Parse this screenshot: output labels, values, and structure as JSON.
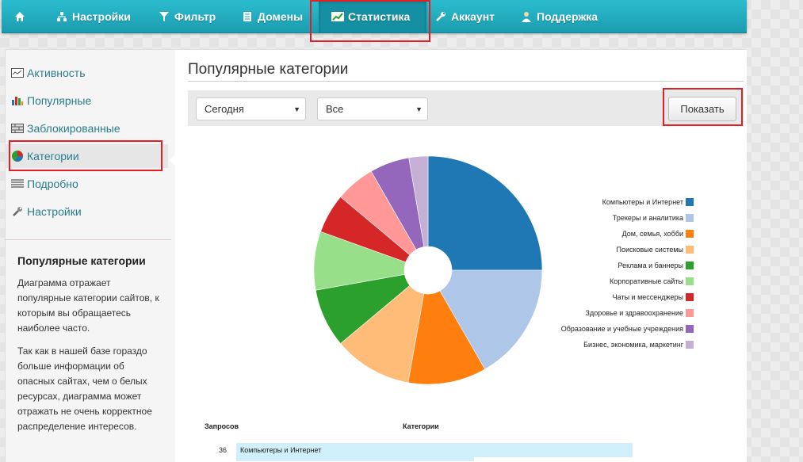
{
  "nav": {
    "home_icon": "home-icon",
    "items": [
      {
        "label": "Настройки",
        "icon": "sitemap-icon"
      },
      {
        "label": "Фильтр",
        "icon": "filter-icon"
      },
      {
        "label": "Домены",
        "icon": "document-icon"
      },
      {
        "label": "Статистика",
        "icon": "chart-icon",
        "active": true
      },
      {
        "label": "Аккаунт",
        "icon": "wrench-icon"
      },
      {
        "label": "Поддержка",
        "icon": "user-icon"
      }
    ]
  },
  "sidebar": {
    "items": [
      {
        "label": "Активность",
        "icon": "activity-icon"
      },
      {
        "label": "Популярные",
        "icon": "bar-chart-icon"
      },
      {
        "label": "Заблокированные",
        "icon": "blocked-icon"
      },
      {
        "label": "Категории",
        "icon": "pie-chart-icon",
        "active": true
      },
      {
        "label": "Подробно",
        "icon": "list-icon"
      },
      {
        "label": "Настройки",
        "icon": "wrench-icon"
      }
    ],
    "info_title": "Популярные категории",
    "info_paragraphs": [
      "Диаграмма отражает популярные категории сайтов, к которым вы обращаетесь наиболее часто.",
      "Так как в нашей базе гораздо больше информации об опасных сайтах, чем о белых ресурсах, диаграмма может отражать не очень корректное распределение интересов."
    ]
  },
  "main": {
    "title": "Популярные категории",
    "period_select": "Сегодня",
    "filter_select": "Все",
    "show_button": "Показать"
  },
  "table": {
    "header_requests": "Запросов",
    "header_categories": "Категории",
    "rows": [
      {
        "count": "36",
        "category": "Компьютеры и Интернет"
      }
    ]
  },
  "chart_data": {
    "type": "pie",
    "title": "",
    "legend_position": "right",
    "series": [
      {
        "name": "Компьютеры и Интернет",
        "value": 25.0,
        "color": "#1f77b4"
      },
      {
        "name": "Трекеры и аналитика",
        "value": 16.7,
        "color": "#aec7e8"
      },
      {
        "name": "Дом, семья, хобби",
        "value": 11.1,
        "color": "#ff7f0e"
      },
      {
        "name": "Поисковые системы",
        "value": 11.1,
        "color": "#ffbb78"
      },
      {
        "name": "Реклама и баннеры",
        "value": 8.3,
        "color": "#2ca02c"
      },
      {
        "name": "Корпоративные сайты",
        "value": 8.3,
        "color": "#98df8a"
      },
      {
        "name": "Чаты и мессенджеры",
        "value": 5.6,
        "color": "#d62728"
      },
      {
        "name": "Здоровье и здравоохранение",
        "value": 5.6,
        "color": "#ff9896"
      },
      {
        "name": "Образование и учебные учреждения",
        "value": 5.6,
        "color": "#9467bd"
      },
      {
        "name": "Бизнес, экономика, маркетинг",
        "value": 2.7,
        "color": "#c5b0d5"
      }
    ]
  }
}
